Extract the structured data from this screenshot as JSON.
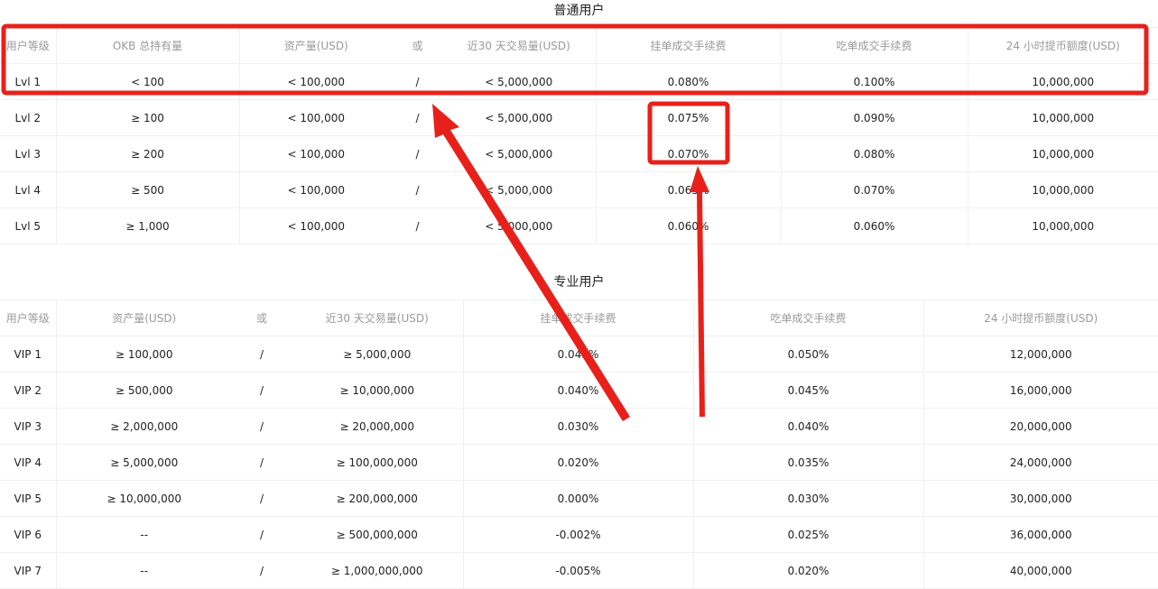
{
  "regular": {
    "title": "普通用户",
    "headers": [
      "用户等级",
      "OKB 总持有量",
      "资产量(USD)",
      "或",
      "近30 天交易量(USD)",
      "挂单成交手续费",
      "吃单成交手续费",
      "24 小时提币额度(USD)"
    ],
    "rows": [
      [
        "Lvl 1",
        "< 100",
        "< 100,000",
        "/",
        "< 5,000,000",
        "0.080%",
        "0.100%",
        "10,000,000"
      ],
      [
        "Lvl 2",
        "≥ 100",
        "< 100,000",
        "/",
        "< 5,000,000",
        "0.075%",
        "0.090%",
        "10,000,000"
      ],
      [
        "Lvl 3",
        "≥ 200",
        "< 100,000",
        "/",
        "< 5,000,000",
        "0.070%",
        "0.080%",
        "10,000,000"
      ],
      [
        "Lvl 4",
        "≥ 500",
        "< 100,000",
        "/",
        "< 5,000,000",
        "0.065%",
        "0.070%",
        "10,000,000"
      ],
      [
        "Lvl 5",
        "≥ 1,000",
        "< 100,000",
        "/",
        "< 5,000,000",
        "0.060%",
        "0.060%",
        "10,000,000"
      ]
    ]
  },
  "pro": {
    "title": "专业用户",
    "headers": [
      "用户等级",
      "资产量(USD)",
      "或",
      "近30 天交易量(USD)",
      "挂单成交手续费",
      "吃单成交手续费",
      "24 小时提币额度(USD)"
    ],
    "rows": [
      [
        "VIP 1",
        "≥ 100,000",
        "/",
        "≥ 5,000,000",
        "0.045%",
        "0.050%",
        "12,000,000"
      ],
      [
        "VIP 2",
        "≥ 500,000",
        "/",
        "≥ 10,000,000",
        "0.040%",
        "0.045%",
        "16,000,000"
      ],
      [
        "VIP 3",
        "≥ 2,000,000",
        "/",
        "≥ 20,000,000",
        "0.030%",
        "0.040%",
        "20,000,000"
      ],
      [
        "VIP 4",
        "≥ 5,000,000",
        "/",
        "≥ 100,000,000",
        "0.020%",
        "0.035%",
        "24,000,000"
      ],
      [
        "VIP 5",
        "≥ 10,000,000",
        "/",
        "≥ 200,000,000",
        "0.000%",
        "0.030%",
        "30,000,000"
      ],
      [
        "VIP 6",
        "--",
        "/",
        "≥ 500,000,000",
        "-0.002%",
        "0.025%",
        "36,000,000"
      ],
      [
        "VIP 7",
        "--",
        "/",
        "≥ 1,000,000,000",
        "-0.005%",
        "0.020%",
        "40,000,000"
      ]
    ]
  },
  "colors": {
    "annotation": "#e8201a",
    "grid_line": "#f0f0f0",
    "header_text": "#9a9a9a"
  }
}
